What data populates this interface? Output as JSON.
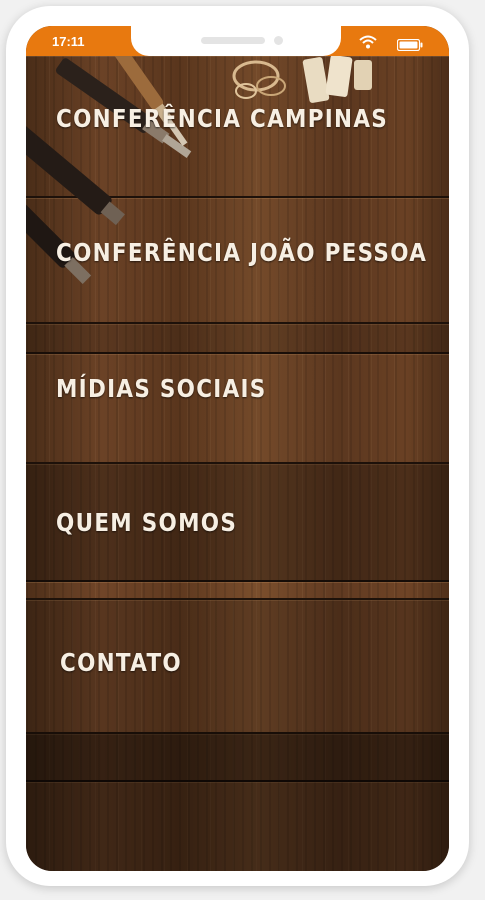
{
  "status_bar": {
    "time": "17:11",
    "icons": [
      "wifi-icon",
      "battery-icon"
    ],
    "background_color": "#e8790f"
  },
  "menu": {
    "items": [
      {
        "label": "CONFERÊNCIA CAMPINAS"
      },
      {
        "label": "CONFERÊNCIA JOÃO PESSOA"
      },
      {
        "label": "MÍDIAS SOCIAIS"
      },
      {
        "label": "QUEM SOMOS"
      },
      {
        "label": "CONTATO"
      }
    ]
  },
  "colors": {
    "accent": "#e8790f",
    "text": "#f7efe3",
    "wood": "#5a361d"
  }
}
